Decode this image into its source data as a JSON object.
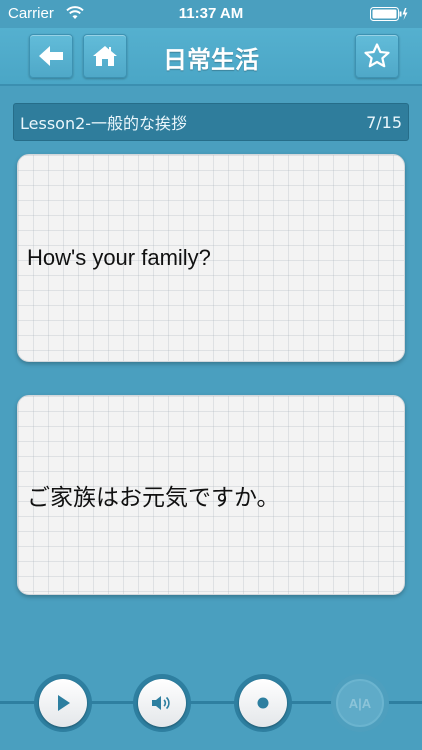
{
  "status": {
    "carrier": "Carrier",
    "time": "11:37 AM"
  },
  "nav": {
    "title": "日常生活"
  },
  "lesson": {
    "title": "Lesson2-一般的な挨拶",
    "progress": "7/15"
  },
  "cards": {
    "english": "How's your family?",
    "japanese": "ご家族はお元気ですか。"
  },
  "controls": {
    "translate_label": "A|A"
  },
  "icons": [
    "wifi-icon",
    "battery-icon",
    "back-arrow-icon",
    "home-icon",
    "star-icon",
    "play-icon",
    "speaker-icon",
    "record-icon",
    "translate-icon"
  ]
}
